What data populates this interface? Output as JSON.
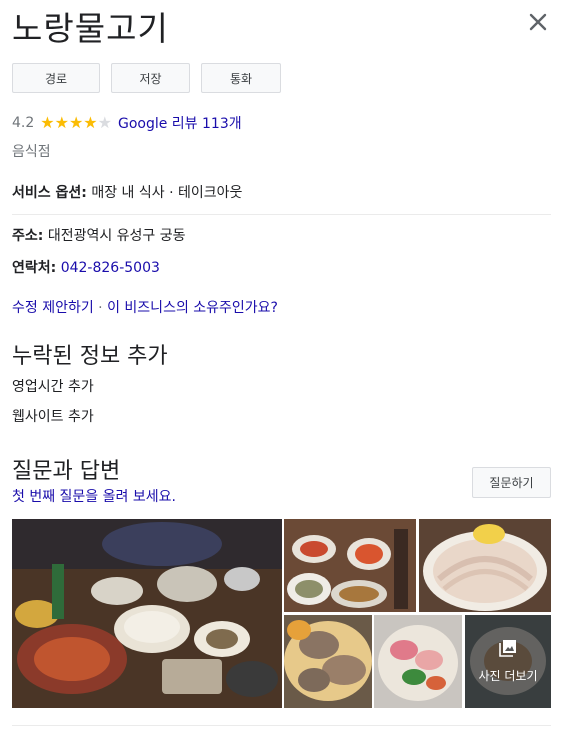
{
  "place": {
    "title": "노랑물고기",
    "category": "음식점"
  },
  "actions": {
    "route": "경로",
    "save": "저장",
    "call": "통화"
  },
  "rating": {
    "value": "4.2",
    "stars": 4.2,
    "reviews_link": "Google 리뷰 113개"
  },
  "details": {
    "service_label": "서비스 옵션:",
    "service_value": "매장 내 식사 · 테이크아웃",
    "address_label": "주소:",
    "address_value": "대전광역시 유성구 궁동",
    "phone_label": "연락처:",
    "phone_value": "042-826-5003"
  },
  "edit": {
    "suggest": "수정 제안하기",
    "sep": " · ",
    "owner": "이 비즈니스의 소유주인가요?"
  },
  "missing": {
    "title": "누락된 정보 추가",
    "hours": "영업시간 추가",
    "website": "웹사이트 추가"
  },
  "qa": {
    "title": "질문과 답변",
    "prompt": "첫 번째 질문을 올려 보세요.",
    "ask_button": "질문하기"
  },
  "photos": {
    "more_label": "사진 더보기"
  },
  "colors": {
    "link": "#1a0dab",
    "star": "#fbbc04",
    "border": "#dadce0"
  },
  "icons": [
    "close-icon",
    "star-icon",
    "photo-library-icon"
  ]
}
